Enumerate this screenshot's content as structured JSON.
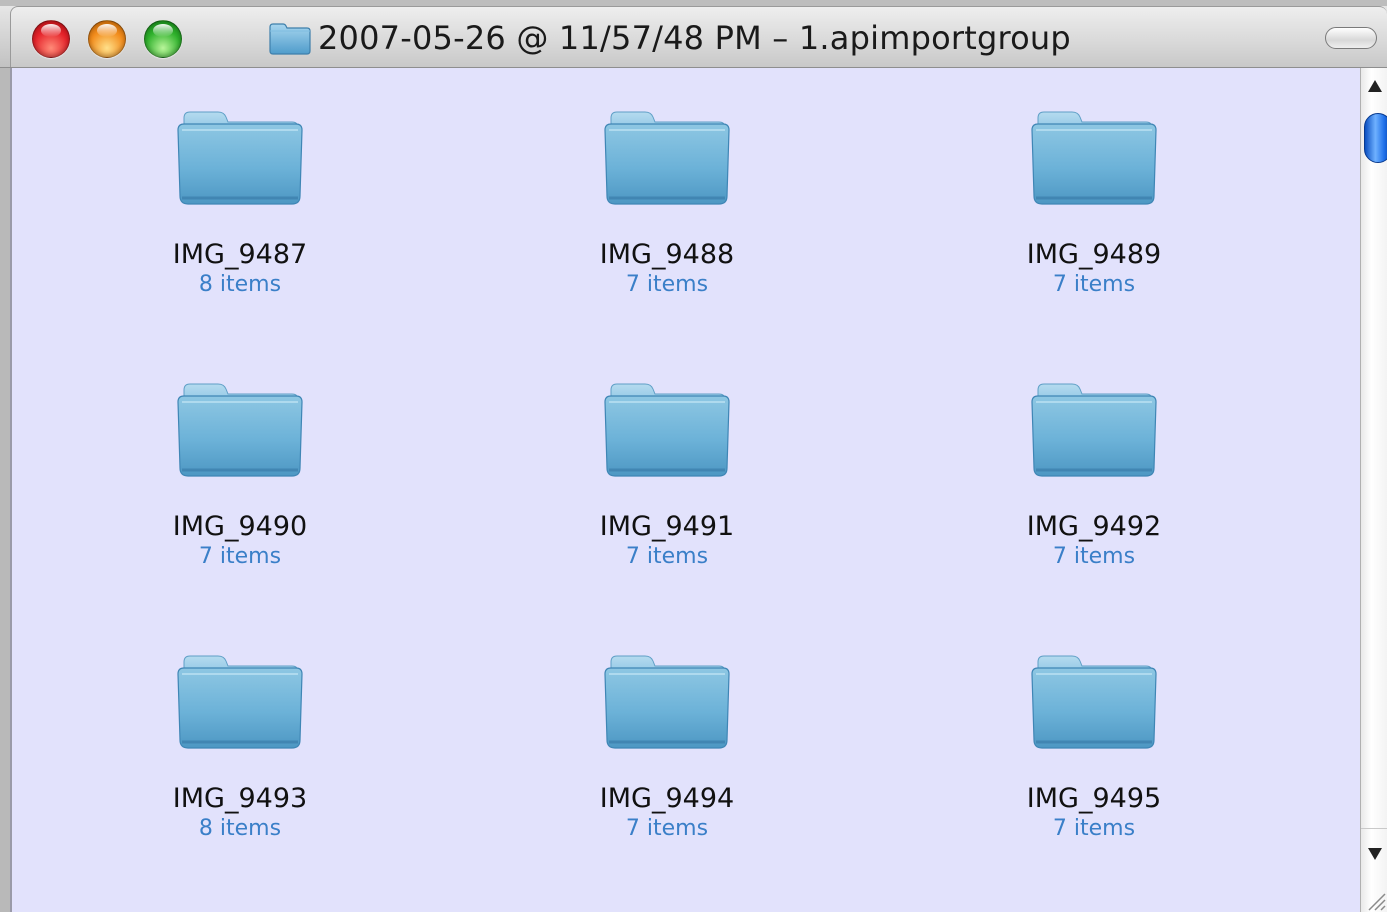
{
  "window": {
    "title": "2007-05-26 @ 11/57/48 PM – 1.apimportgroup",
    "colors": {
      "content_background": "#e2e2fc",
      "folder_blue": "#5aa6d0",
      "count_text": "#3a7fc8"
    }
  },
  "items": [
    {
      "name": "IMG_9487",
      "count": "8 items",
      "icon": "folder-icon"
    },
    {
      "name": "IMG_9488",
      "count": "7 items",
      "icon": "folder-icon"
    },
    {
      "name": "IMG_9489",
      "count": "7 items",
      "icon": "folder-icon"
    },
    {
      "name": "IMG_9490",
      "count": "7 items",
      "icon": "folder-icon"
    },
    {
      "name": "IMG_9491",
      "count": "7 items",
      "icon": "folder-icon"
    },
    {
      "name": "IMG_9492",
      "count": "7 items",
      "icon": "folder-icon"
    },
    {
      "name": "IMG_9493",
      "count": "8 items",
      "icon": "folder-icon"
    },
    {
      "name": "IMG_9494",
      "count": "7 items",
      "icon": "folder-icon"
    },
    {
      "name": "IMG_9495",
      "count": "7 items",
      "icon": "folder-icon"
    }
  ]
}
